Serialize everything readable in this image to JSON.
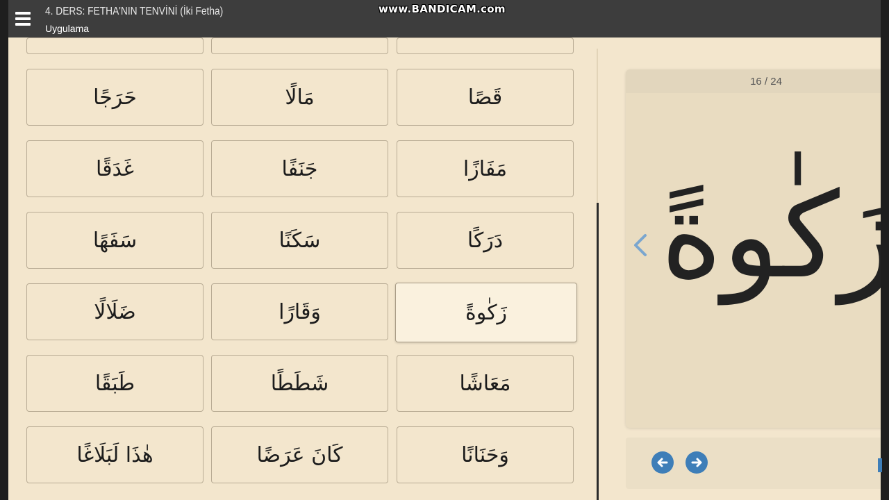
{
  "header": {
    "title": "4. DERS: FETHA'NIN TENVİNİ (İki Fetha)",
    "subtitle": "Uygulama"
  },
  "watermark": "www.BANDICAM.com",
  "words": {
    "r1c1": "قَصًا",
    "r1c2": "مَالًا",
    "r1c3": "حَرَجًا",
    "r2c1": "مَفَازًا",
    "r2c2": "جَنَفًا",
    "r2c3": "غَدَقًا",
    "r3c1": "دَرَكًا",
    "r3c2": "سَكَنًا",
    "r3c3": "سَفَهًا",
    "r4c1": "زَكٰوةً",
    "r4c2": "وَقَارًا",
    "r4c3": "ضَلَالًا",
    "r5c1": "مَعَاشًا",
    "r5c2": "شَطَطًا",
    "r5c3": "طَبَقًا",
    "r6c1": "وَحَنَانًا",
    "r6c2": "كَانَ عَرَضًا",
    "r6c3": "هٰذَا لَبَلَاغًا"
  },
  "viewer": {
    "counter": "16 / 24",
    "current_word": "زَكٰوةً"
  },
  "icons": {
    "menu": "hamburger-icon",
    "prev_chevron": "chevron-left-icon",
    "prev": "arrow-left-circle-icon",
    "next": "arrow-right-circle-icon"
  },
  "colors": {
    "accent": "#3e7eb8",
    "background": "#f3e6cd",
    "topbar": "#3d3d3d"
  }
}
